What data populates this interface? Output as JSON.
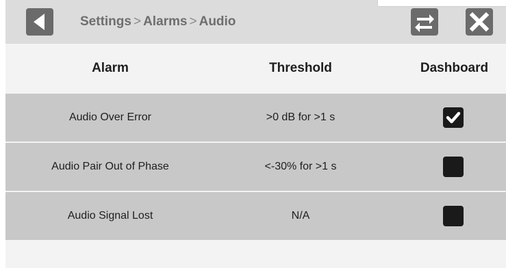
{
  "header": {
    "breadcrumb": [
      "Settings",
      "Alarms",
      "Audio"
    ],
    "separator": ">",
    "back_icon": "back-arrow-icon",
    "swap_icon": "swap-arrows-icon",
    "close_icon": "close-icon"
  },
  "table": {
    "columns": {
      "alarm": "Alarm",
      "threshold": "Threshold",
      "dashboard": "Dashboard"
    },
    "rows": [
      {
        "alarm": "Audio Over Error",
        "threshold": ">0 dB for >1 s",
        "dashboard": true
      },
      {
        "alarm": "Audio Pair Out of Phase",
        "threshold": "<-30% for >1 s",
        "dashboard": false
      },
      {
        "alarm": "Audio Signal Lost",
        "threshold": "N/A",
        "dashboard": false
      }
    ]
  },
  "colors": {
    "header_bg": "#dcdcdc",
    "row_bg": "#c8c8c8",
    "button_bg": "#6b6b6b",
    "checkbox_bg": "#1a1a1a"
  }
}
